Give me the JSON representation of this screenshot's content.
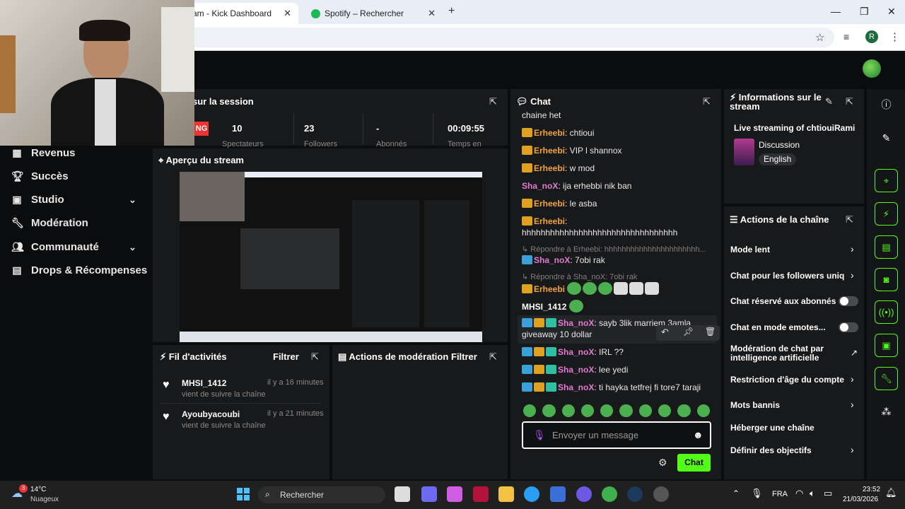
{
  "browser": {
    "tabs": [
      {
        "label": "am - Kick Dashboard",
        "close": "✕"
      },
      {
        "label": "Spotify – Rechercher",
        "close": "✕"
      }
    ],
    "new_tab": "+",
    "profile_initial": "R"
  },
  "sidebar": {
    "items": [
      {
        "label": "Revenus",
        "icon": "chart-icon"
      },
      {
        "label": "Succès",
        "icon": "trophy-icon"
      },
      {
        "label": "Studio",
        "icon": "studio-icon",
        "chevron": "⌄"
      },
      {
        "label": "Modération",
        "icon": "wrench-icon"
      },
      {
        "label": "Communauté",
        "icon": "people-icon",
        "chevron": "⌄"
      },
      {
        "label": "Drops & Récompenses",
        "icon": "gift-icon"
      }
    ]
  },
  "session": {
    "title": "sur la session",
    "live_badge": "NG",
    "stats": [
      {
        "value": "10",
        "label": "Spectateurs"
      },
      {
        "value": "23",
        "label": "Followers"
      },
      {
        "value": "-",
        "label": "Abonnés"
      },
      {
        "value": "00:09:55",
        "label": "Temps en"
      }
    ]
  },
  "preview": {
    "title": "Aperçu du stream"
  },
  "activity": {
    "title": "Fil d'activités",
    "filter": "Filtrer",
    "items": [
      {
        "name": "MHSI_1412",
        "sub": "vient de suivre la chaîne",
        "time": "il y a 16 minutes"
      },
      {
        "name": "Ayoubyacoubi",
        "sub": "vient de suivre la chaîne",
        "time": "il y a 21 minutes"
      }
    ]
  },
  "modactions": {
    "title": "Actions de modération",
    "filter": "Filtrer"
  },
  "chat": {
    "title": "Chat",
    "messages": [
      {
        "user": "",
        "text": "chaine het"
      },
      {
        "user": "Erheebi",
        "text": ": chtioui"
      },
      {
        "user": "Erheebi",
        "text": ": VIP l shannox"
      },
      {
        "user": "Erheebi",
        "text": ": w mod"
      },
      {
        "user": "Sha_noX",
        "text": ": ija erhebbi nik ban"
      },
      {
        "user": "Erheebi",
        "text": ": le asba"
      },
      {
        "user": "Erheebi",
        "text": ":"
      },
      {
        "user": "",
        "text": "hhhhhhhhhhhhhhhhhhhhhhhhhhhhhhhhh"
      },
      {
        "reply": "Répondre à Erheebi: hhhhhhhhhhhhhhhhhhhhhh..."
      },
      {
        "user": "Sha_noX",
        "text": ": 7obi rak"
      },
      {
        "reply": "Répondre à Sha_noX: 7obi rak"
      },
      {
        "user": "Erheebi",
        "text": ":"
      },
      {
        "user": "MHSI_1412",
        "text": ":"
      },
      {
        "user": "Sha_noX",
        "text": ": sayb 3lik marriem 3amla"
      },
      {
        "user": "",
        "text": "giveaway 10 dollar"
      },
      {
        "user": "Sha_noX",
        "text": ": IRL ??"
      },
      {
        "user": "Sha_noX",
        "text": ": lee yedi"
      },
      {
        "user": "Sha_noX",
        "text": ": ti hayka tetfrej fi tore7 taraji"
      }
    ],
    "input_placeholder": "Envoyer un message",
    "send_label": "Chat"
  },
  "info": {
    "title": "Informations sur le stream",
    "stream_title": "Live streaming of chtiouiRami",
    "category": "Discussion",
    "language": "English"
  },
  "channel_actions": {
    "title": "Actions de la chaîne",
    "items": [
      {
        "label": "Mode lent",
        "kind": "chevron"
      },
      {
        "label": "Chat pour les followers uniq",
        "kind": "chevron"
      },
      {
        "label": "Chat réservé aux abonnés",
        "kind": "toggle"
      },
      {
        "label": "Chat en mode emotes...",
        "kind": "toggle"
      },
      {
        "label": "Modération de chat par intelligence artificielle",
        "kind": "external"
      },
      {
        "label": "Restriction d'âge du compte",
        "kind": "chevron"
      },
      {
        "label": "Mots bannis",
        "kind": "chevron"
      },
      {
        "label": "Héberger une chaîne",
        "kind": "none"
      },
      {
        "label": "Définir des objectifs",
        "kind": "chevron"
      }
    ]
  },
  "taskbar": {
    "weather_temp": "14°C",
    "weather_desc": "Nuageux",
    "weather_badge": "3",
    "search": "Rechercher",
    "lang": "FRA",
    "time": "23:52",
    "date": "21/03/2026"
  },
  "colors": {
    "accent": "#53fc18",
    "bg": "#0b0c0d",
    "panel": "#18191b"
  }
}
